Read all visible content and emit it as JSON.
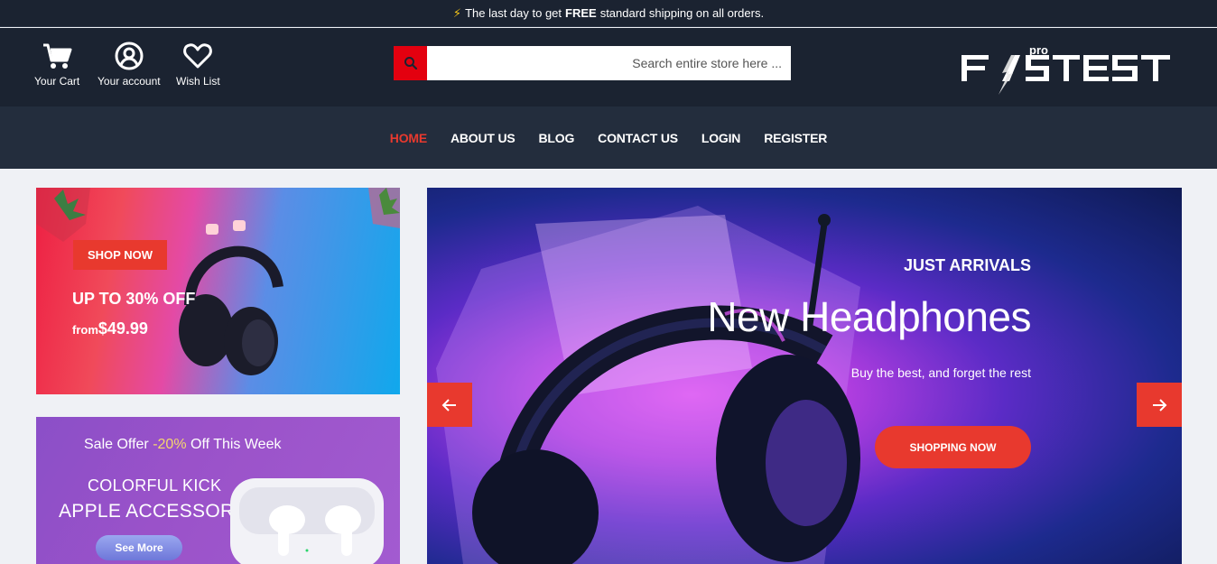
{
  "announcement": {
    "before": "The last day to get",
    "bold": "FREE",
    "after": "standard shipping on all orders."
  },
  "header": {
    "cart_label": "Your Cart",
    "account_label": "Your account",
    "wishlist_label": "Wish List",
    "search_placeholder": "Search entire store here ...",
    "logo_main": "F ST",
    "logo_pro": "pro",
    "logo_text": "FASTEST"
  },
  "nav": {
    "items": [
      {
        "label": "HOME",
        "active": true
      },
      {
        "label": "ABOUT US"
      },
      {
        "label": "BLOG"
      },
      {
        "label": "CONTACT US"
      },
      {
        "label": "LOGIN"
      },
      {
        "label": "REGISTER"
      }
    ]
  },
  "banner1": {
    "button": "SHOP NOW",
    "headline": "UP TO 30% OFF",
    "from_label": "from",
    "price": "$49.99"
  },
  "banner2": {
    "sale_before": "Sale Offer ",
    "sale_pct": "-20%",
    "sale_after": " Off This Week",
    "line1": "COLORFUL KICK",
    "line2": "APPLE ACCESSORIES",
    "button": "See More"
  },
  "hero": {
    "kicker": "JUST ARRIVALS",
    "title": "New Headphones",
    "subtitle": "Buy the best, and forget the rest",
    "button": "SHOPPING NOW"
  },
  "colors": {
    "accent": "#e8392e",
    "header_bg": "#1b2331",
    "nav_bg": "#232d3d",
    "search_btn": "#e3000f"
  }
}
